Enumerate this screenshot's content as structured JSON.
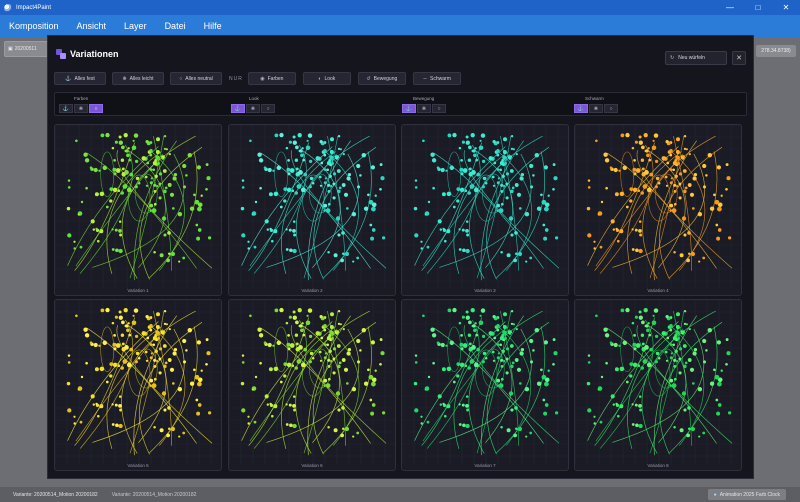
{
  "window": {
    "title": "Impact4Paint",
    "controls": [
      "—",
      "□",
      "✕"
    ]
  },
  "menu": [
    "Komposition",
    "Ansicht",
    "Layer",
    "Datei",
    "Hilfe"
  ],
  "background": {
    "toolbar_text": "20200511",
    "right_pill": "278.34.8738)",
    "status_left": "Variante: 20200514_Motion 20200182",
    "status_left2": "Variante: 20200514_Motion 20200182",
    "status_right": "Animation 2025 Farb Clock"
  },
  "modal": {
    "title": "Variationen",
    "reroll_label": "Neu würfeln",
    "close_icon": "close-icon",
    "actions": [
      {
        "label": "Alles fest",
        "icon": "anchor-icon"
      },
      {
        "label": "Alles leicht",
        "icon": "feather-icon"
      },
      {
        "label": "Alles neutral",
        "icon": "neutral-icon"
      }
    ],
    "only_label": "NUR",
    "only_actions": [
      {
        "label": "Farben",
        "icon": "palette-icon"
      },
      {
        "label": "Look",
        "icon": "look-icon"
      },
      {
        "label": "Bewegung",
        "icon": "motion-icon"
      },
      {
        "label": "Schwarm",
        "icon": "swarm-icon"
      }
    ],
    "filters": [
      {
        "label": "Farben",
        "active": 2
      },
      {
        "label": "Look",
        "active": 0
      },
      {
        "label": "Bewegung",
        "active": 0
      },
      {
        "label": "Schwarm",
        "active": 0
      }
    ],
    "variations": [
      {
        "label": "Variation 1",
        "colors": [
          "#b9f23a",
          "#5ee23a",
          "#7fe13c"
        ]
      },
      {
        "label": "Variation 2",
        "colors": [
          "#35f2d2",
          "#2bd7c0",
          "#5cf0dd"
        ]
      },
      {
        "label": "Variation 3",
        "colors": [
          "#2ef0d2",
          "#29d8c2",
          "#3fead0"
        ]
      },
      {
        "label": "Variation 4",
        "colors": [
          "#ffb224",
          "#f59a1a",
          "#ffc83b"
        ]
      },
      {
        "label": "Variation 5",
        "colors": [
          "#f6e12a",
          "#e6c21a",
          "#fff04a"
        ]
      },
      {
        "label": "Variation 6",
        "colors": [
          "#b8f03a",
          "#7edb31",
          "#d4f548"
        ]
      },
      {
        "label": "Variation 7",
        "colors": [
          "#2ff07a",
          "#1ed86a",
          "#5bf58e"
        ]
      },
      {
        "label": "Variation 8",
        "colors": [
          "#37f06a",
          "#1fd857",
          "#6af37f"
        ]
      }
    ]
  },
  "accent": "#7b57d8"
}
